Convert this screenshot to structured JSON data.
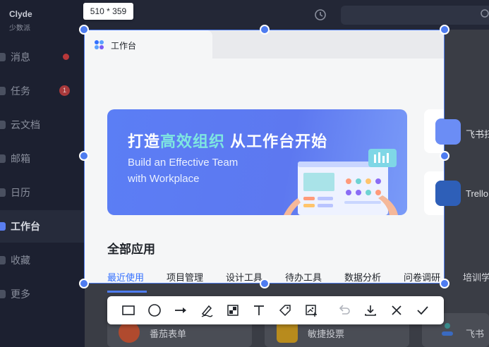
{
  "user": {
    "name": "Clyde",
    "subtitle": "少数派"
  },
  "sidebar": {
    "items": [
      {
        "label": "消息"
      },
      {
        "label": "任务",
        "badge": "1"
      },
      {
        "label": "云文档"
      },
      {
        "label": "邮箱"
      },
      {
        "label": "日历"
      },
      {
        "label": "工作台"
      },
      {
        "label": "收藏"
      },
      {
        "label": "更多"
      }
    ]
  },
  "selection": {
    "size_label": "510 * 359"
  },
  "workspace": {
    "tab_label": "工作台",
    "banner": {
      "title_pre": "打造",
      "title_hl": "高效组织",
      "title_post": " 从工作台开始",
      "sub1": "Build an Effective Team",
      "sub2": "with Workplace"
    },
    "side_apps": [
      {
        "label": "飞书扫"
      },
      {
        "label": "Trello"
      }
    ],
    "section_title": "全部应用",
    "categories": [
      "最近使用",
      "项目管理",
      "设计工具",
      "待办工具",
      "数据分析",
      "问卷调研",
      "培训学"
    ],
    "bottom_apps": [
      {
        "label": "番茄表单"
      },
      {
        "label": "敏捷投票"
      },
      {
        "label": "飞书"
      }
    ]
  },
  "colors": {
    "accent": "#4e7cf0",
    "banner": "#5b7ef5",
    "highlight": "#7ee6e0"
  },
  "toolbar": {
    "tools": [
      "rectangle-tool",
      "ellipse-tool",
      "arrow-tool",
      "pen-tool",
      "mosaic-tool",
      "text-tool",
      "tag-tool",
      "image-tool",
      "undo",
      "download",
      "cancel",
      "confirm"
    ]
  }
}
